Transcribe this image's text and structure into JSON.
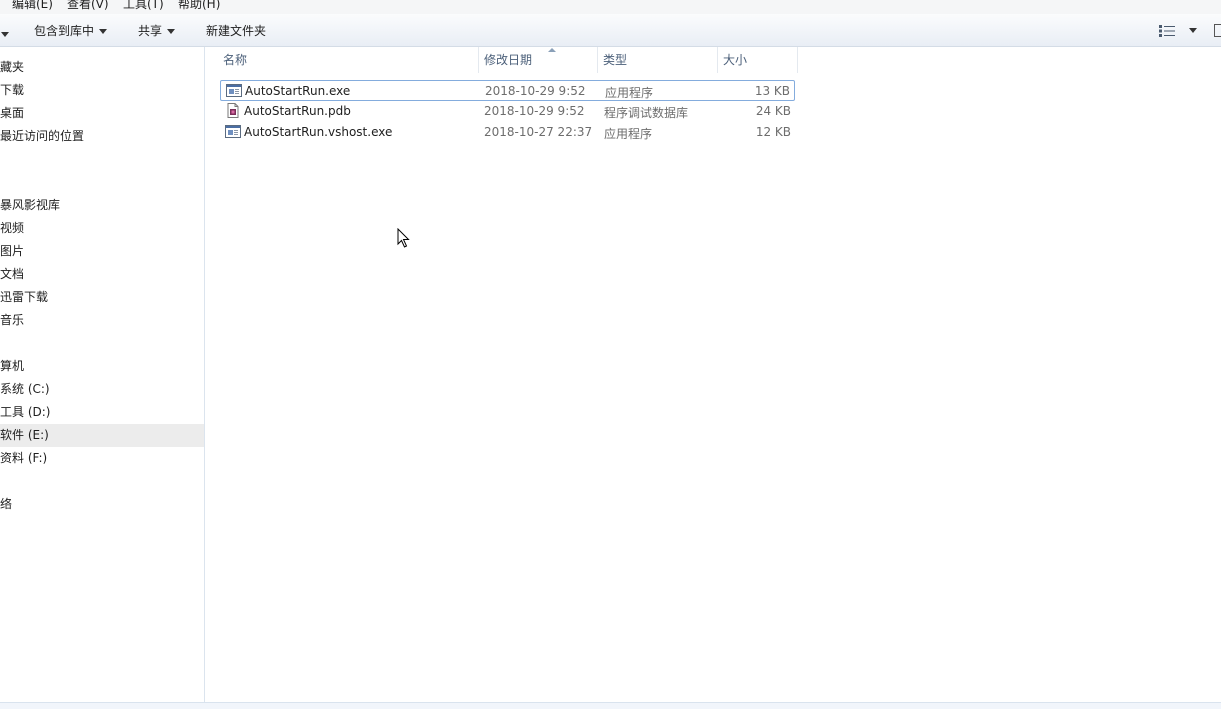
{
  "menu": {
    "edit": "编辑(E)",
    "view": "查看(V)",
    "tools": "工具(T)",
    "help": "帮助(H)"
  },
  "toolbar": {
    "include_in_library": "包含到库中",
    "share": "共享",
    "new_folder": "新建文件夹"
  },
  "nav": {
    "favorites": {
      "header": "藏夹",
      "items": [
        "下载",
        "桌面",
        "最近访问的位置"
      ]
    },
    "libraries": {
      "header": "",
      "items": [
        "暴风影视库",
        "视频",
        "图片",
        "文档",
        "迅雷下载",
        "音乐"
      ]
    },
    "computer": {
      "header": "算机",
      "items": [
        "系统 (C:)",
        "工具 (D:)",
        "软件 (E:)",
        "资料 (F:)"
      ],
      "selected": "软件 (E:)"
    },
    "network": {
      "header": "络"
    }
  },
  "columns": {
    "name": "名称",
    "date": "修改日期",
    "type": "类型",
    "size": "大小"
  },
  "files": [
    {
      "name": "AutoStartRun.exe",
      "date": "2018-10-29 9:52",
      "type": "应用程序",
      "size": "13 KB",
      "icon": "exe-icon"
    },
    {
      "name": "AutoStartRun.pdb",
      "date": "2018-10-29 9:52",
      "type": "程序调试数据库",
      "size": "24 KB",
      "icon": "pdb-icon"
    },
    {
      "name": "AutoStartRun.vshost.exe",
      "date": "2018-10-27 22:37",
      "type": "应用程序",
      "size": "12 KB",
      "icon": "exe-icon"
    }
  ],
  "colors": {
    "selection": "#ececec",
    "focus_border": "#84acdd",
    "column_header_text": "#4c607a"
  }
}
